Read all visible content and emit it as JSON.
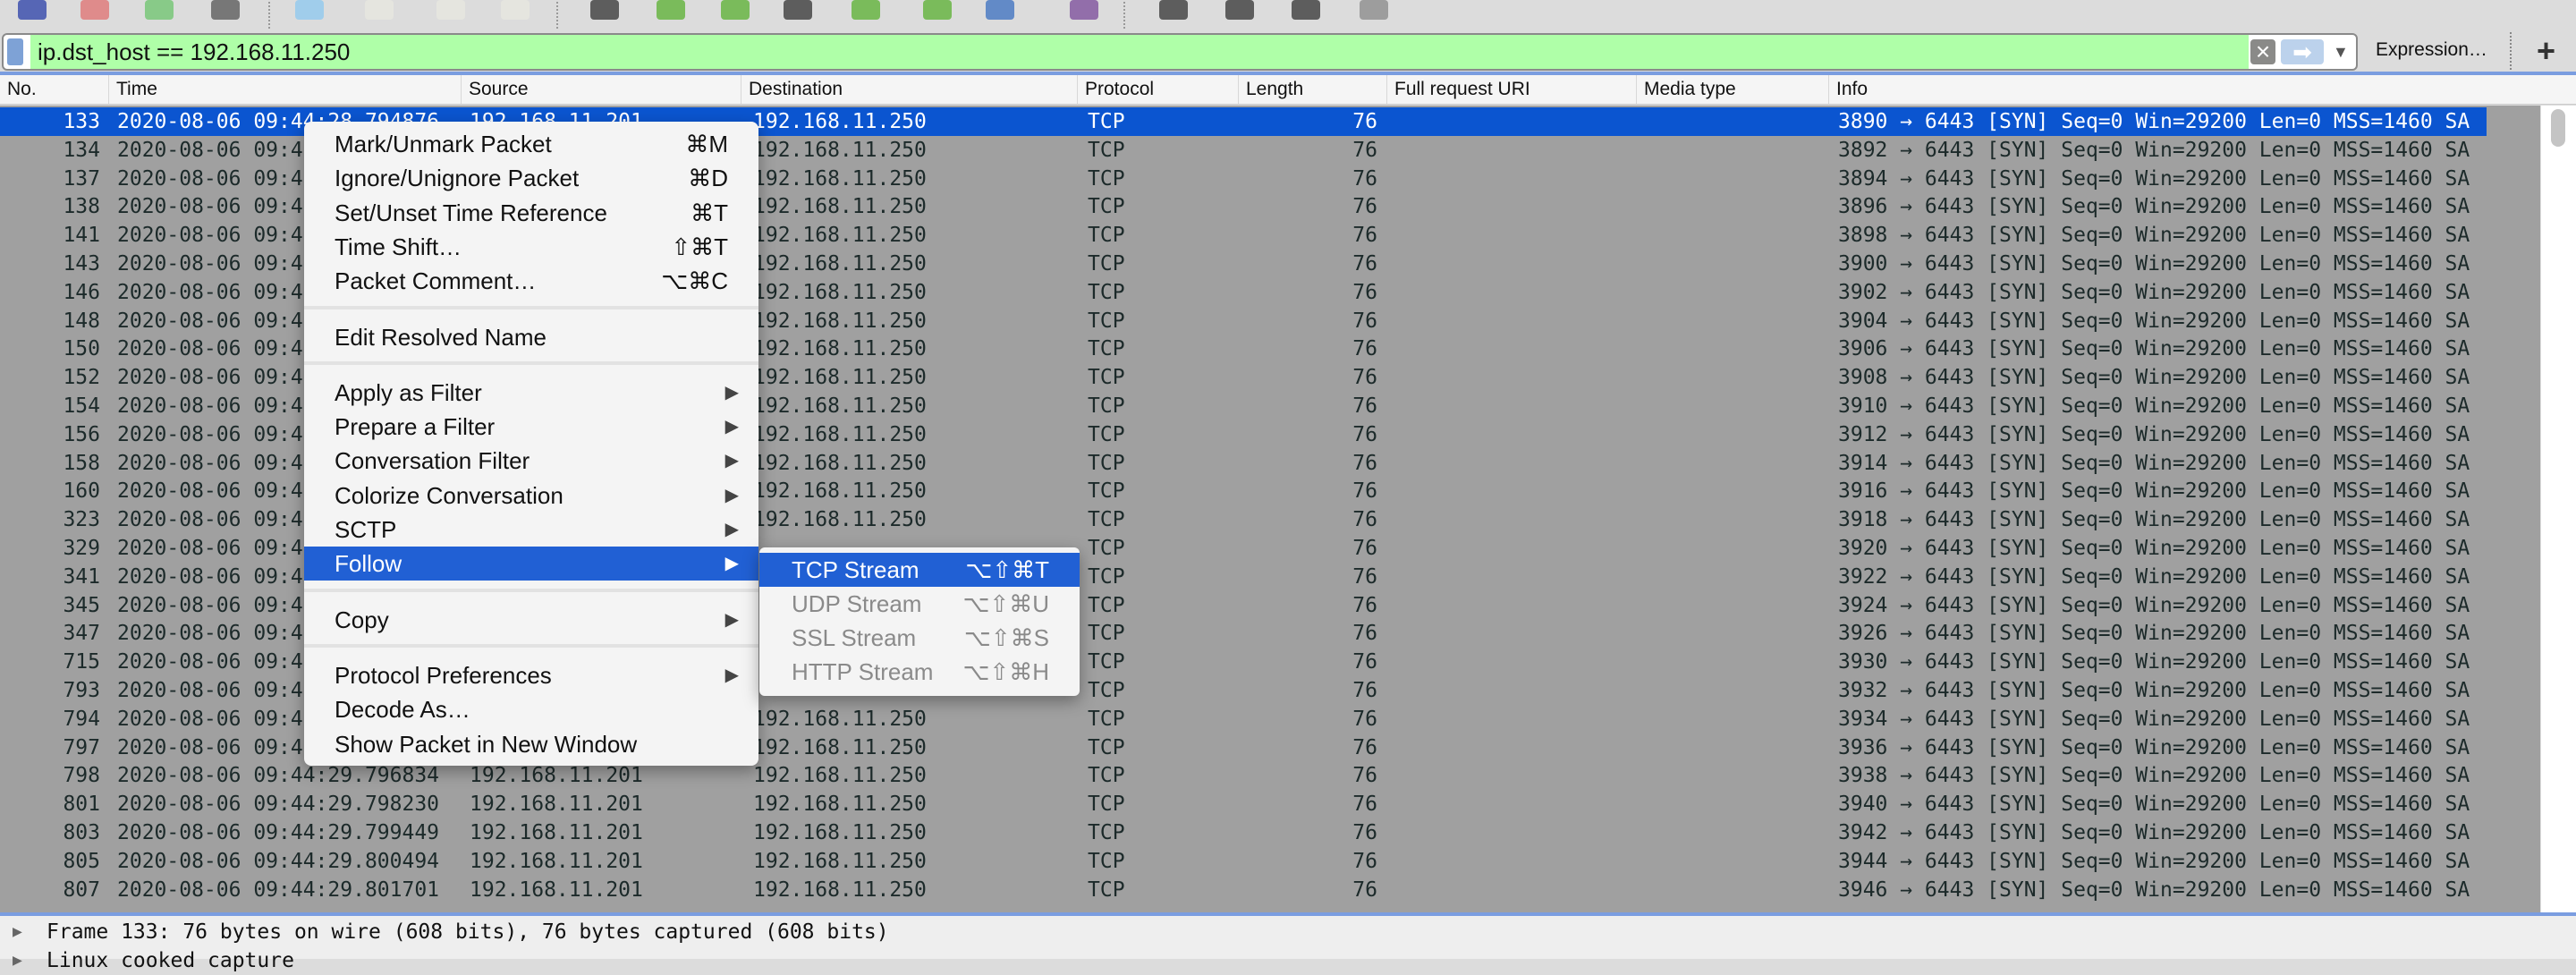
{
  "colors": {
    "accent": "#2160d4",
    "selected_row": "#0b55d0",
    "filter_valid": "#afffa8"
  },
  "toolbar": {
    "icons": [
      "shark-fin-start-icon",
      "stop-icon",
      "restart-icon",
      "options-gear-icon",
      "open-file-icon",
      "save-file-icon",
      "close-file-icon",
      "reload-file-icon",
      "find-packet-icon",
      "go-back-icon",
      "go-forward-icon",
      "go-to-packet-icon",
      "go-first-icon",
      "go-last-icon",
      "autoscroll-icon",
      "colorize-icon",
      "zoom-in-icon",
      "zoom-out-icon",
      "zoom-normal-icon",
      "resize-columns-icon"
    ]
  },
  "filter": {
    "value": "ip.dst_host == 192.168.11.250",
    "clear_icon": "clear-x-icon",
    "apply_icon": "arrow-right-icon",
    "expression_label": "Expression…",
    "add_label": "+"
  },
  "columns": [
    "No.",
    "Time",
    "Source",
    "Destination",
    "Protocol",
    "Length",
    "Full request URI",
    "Media type",
    "Info"
  ],
  "packets": [
    {
      "no": "133",
      "time": "2020-08-06 09:44:28.794876",
      "src": "192.168.11.201",
      "dst": "192.168.11.250",
      "proto": "TCP",
      "len": "76",
      "info": "3890 → 6443 [SYN] Seq=0 Win=29200 Len=0 MSS=1460 SA"
    },
    {
      "no": "134",
      "time": "2020-08-06 09:4",
      "src": "",
      "dst": "192.168.11.250",
      "proto": "TCP",
      "len": "76",
      "info": "3892 → 6443 [SYN] Seq=0 Win=29200 Len=0 MSS=1460 SA"
    },
    {
      "no": "137",
      "time": "2020-08-06 09:4",
      "src": "",
      "dst": "192.168.11.250",
      "proto": "TCP",
      "len": "76",
      "info": "3894 → 6443 [SYN] Seq=0 Win=29200 Len=0 MSS=1460 SA"
    },
    {
      "no": "138",
      "time": "2020-08-06 09:4",
      "src": "",
      "dst": "192.168.11.250",
      "proto": "TCP",
      "len": "76",
      "info": "3896 → 6443 [SYN] Seq=0 Win=29200 Len=0 MSS=1460 SA"
    },
    {
      "no": "141",
      "time": "2020-08-06 09:4",
      "src": "",
      "dst": "192.168.11.250",
      "proto": "TCP",
      "len": "76",
      "info": "3898 → 6443 [SYN] Seq=0 Win=29200 Len=0 MSS=1460 SA"
    },
    {
      "no": "143",
      "time": "2020-08-06 09:4",
      "src": "",
      "dst": "192.168.11.250",
      "proto": "TCP",
      "len": "76",
      "info": "3900 → 6443 [SYN] Seq=0 Win=29200 Len=0 MSS=1460 SA"
    },
    {
      "no": "146",
      "time": "2020-08-06 09:4",
      "src": "",
      "dst": "192.168.11.250",
      "proto": "TCP",
      "len": "76",
      "info": "3902 → 6443 [SYN] Seq=0 Win=29200 Len=0 MSS=1460 SA"
    },
    {
      "no": "148",
      "time": "2020-08-06 09:4",
      "src": "",
      "dst": "192.168.11.250",
      "proto": "TCP",
      "len": "76",
      "info": "3904 → 6443 [SYN] Seq=0 Win=29200 Len=0 MSS=1460 SA"
    },
    {
      "no": "150",
      "time": "2020-08-06 09:4",
      "src": "",
      "dst": "192.168.11.250",
      "proto": "TCP",
      "len": "76",
      "info": "3906 → 6443 [SYN] Seq=0 Win=29200 Len=0 MSS=1460 SA"
    },
    {
      "no": "152",
      "time": "2020-08-06 09:4",
      "src": "",
      "dst": "192.168.11.250",
      "proto": "TCP",
      "len": "76",
      "info": "3908 → 6443 [SYN] Seq=0 Win=29200 Len=0 MSS=1460 SA"
    },
    {
      "no": "154",
      "time": "2020-08-06 09:4",
      "src": "",
      "dst": "192.168.11.250",
      "proto": "TCP",
      "len": "76",
      "info": "3910 → 6443 [SYN] Seq=0 Win=29200 Len=0 MSS=1460 SA"
    },
    {
      "no": "156",
      "time": "2020-08-06 09:4",
      "src": "",
      "dst": "192.168.11.250",
      "proto": "TCP",
      "len": "76",
      "info": "3912 → 6443 [SYN] Seq=0 Win=29200 Len=0 MSS=1460 SA"
    },
    {
      "no": "158",
      "time": "2020-08-06 09:4",
      "src": "",
      "dst": "192.168.11.250",
      "proto": "TCP",
      "len": "76",
      "info": "3914 → 6443 [SYN] Seq=0 Win=29200 Len=0 MSS=1460 SA"
    },
    {
      "no": "160",
      "time": "2020-08-06 09:4",
      "src": "",
      "dst": "192.168.11.250",
      "proto": "TCP",
      "len": "76",
      "info": "3916 → 6443 [SYN] Seq=0 Win=29200 Len=0 MSS=1460 SA"
    },
    {
      "no": "323",
      "time": "2020-08-06 09:4",
      "src": "",
      "dst": "192.168.11.250",
      "proto": "TCP",
      "len": "76",
      "info": "3918 → 6443 [SYN] Seq=0 Win=29200 Len=0 MSS=1460 SA"
    },
    {
      "no": "329",
      "time": "2020-08-06 09:4",
      "src": "",
      "dst": "",
      "proto": "TCP",
      "len": "76",
      "info": "3920 → 6443 [SYN] Seq=0 Win=29200 Len=0 MSS=1460 SA"
    },
    {
      "no": "341",
      "time": "2020-08-06 09:4",
      "src": "",
      "dst": "",
      "proto": "TCP",
      "len": "76",
      "info": "3922 → 6443 [SYN] Seq=0 Win=29200 Len=0 MSS=1460 SA"
    },
    {
      "no": "345",
      "time": "2020-08-06 09:4",
      "src": "",
      "dst": "",
      "proto": "TCP",
      "len": "76",
      "info": "3924 → 6443 [SYN] Seq=0 Win=29200 Len=0 MSS=1460 SA"
    },
    {
      "no": "347",
      "time": "2020-08-06 09:4",
      "src": "",
      "dst": "",
      "proto": "TCP",
      "len": "76",
      "info": "3926 → 6443 [SYN] Seq=0 Win=29200 Len=0 MSS=1460 SA"
    },
    {
      "no": "715",
      "time": "2020-08-06 09:4",
      "src": "",
      "dst": "",
      "proto": "TCP",
      "len": "76",
      "info": "3930 → 6443 [SYN] Seq=0 Win=29200 Len=0 MSS=1460 SA"
    },
    {
      "no": "793",
      "time": "2020-08-06 09:4",
      "src": "",
      "dst": "",
      "proto": "TCP",
      "len": "76",
      "info": "3932 → 6443 [SYN] Seq=0 Win=29200 Len=0 MSS=1460 SA"
    },
    {
      "no": "794",
      "time": "2020-08-06 09:4",
      "src": "",
      "dst": "192.168.11.250",
      "proto": "TCP",
      "len": "76",
      "info": "3934 → 6443 [SYN] Seq=0 Win=29200 Len=0 MSS=1460 SA"
    },
    {
      "no": "797",
      "time": "2020-08-06 09:4",
      "src": "",
      "dst": "192.168.11.250",
      "proto": "TCP",
      "len": "76",
      "info": "3936 → 6443 [SYN] Seq=0 Win=29200 Len=0 MSS=1460 SA"
    },
    {
      "no": "798",
      "time": "2020-08-06 09:44:29.796834",
      "src": "192.168.11.201",
      "dst": "192.168.11.250",
      "proto": "TCP",
      "len": "76",
      "info": "3938 → 6443 [SYN] Seq=0 Win=29200 Len=0 MSS=1460 SA"
    },
    {
      "no": "801",
      "time": "2020-08-06 09:44:29.798230",
      "src": "192.168.11.201",
      "dst": "192.168.11.250",
      "proto": "TCP",
      "len": "76",
      "info": "3940 → 6443 [SYN] Seq=0 Win=29200 Len=0 MSS=1460 SA"
    },
    {
      "no": "803",
      "time": "2020-08-06 09:44:29.799449",
      "src": "192.168.11.201",
      "dst": "192.168.11.250",
      "proto": "TCP",
      "len": "76",
      "info": "3942 → 6443 [SYN] Seq=0 Win=29200 Len=0 MSS=1460 SA"
    },
    {
      "no": "805",
      "time": "2020-08-06 09:44:29.800494",
      "src": "192.168.11.201",
      "dst": "192.168.11.250",
      "proto": "TCP",
      "len": "76",
      "info": "3944 → 6443 [SYN] Seq=0 Win=29200 Len=0 MSS=1460 SA"
    },
    {
      "no": "807",
      "time": "2020-08-06 09:44:29.801701",
      "src": "192.168.11.201",
      "dst": "192.168.11.250",
      "proto": "TCP",
      "len": "76",
      "info": "3946 → 6443 [SYN] Seq=0 Win=29200 Len=0 MSS=1460 SA"
    }
  ],
  "details": [
    "Frame 133: 76 bytes on wire (608 bits), 76 bytes captured (608 bits)",
    "Linux cooked capture"
  ],
  "context_menu": {
    "groups": [
      [
        {
          "label": "Mark/Unmark Packet",
          "shortcut": "⌘M"
        },
        {
          "label": "Ignore/Unignore Packet",
          "shortcut": "⌘D"
        },
        {
          "label": "Set/Unset Time Reference",
          "shortcut": "⌘T"
        },
        {
          "label": "Time Shift…",
          "shortcut": "⇧⌘T"
        },
        {
          "label": "Packet Comment…",
          "shortcut": "⌥⌘C"
        }
      ],
      [
        {
          "label": "Edit Resolved Name"
        }
      ],
      [
        {
          "label": "Apply as Filter",
          "submenu": true
        },
        {
          "label": "Prepare a Filter",
          "submenu": true
        },
        {
          "label": "Conversation Filter",
          "submenu": true
        },
        {
          "label": "Colorize Conversation",
          "submenu": true
        },
        {
          "label": "SCTP",
          "submenu": true
        },
        {
          "label": "Follow",
          "submenu": true,
          "highlighted": true
        }
      ],
      [
        {
          "label": "Copy",
          "submenu": true
        }
      ],
      [
        {
          "label": "Protocol Preferences",
          "submenu": true
        },
        {
          "label": "Decode As…"
        },
        {
          "label": "Show Packet in New Window"
        }
      ]
    ]
  },
  "follow_submenu": [
    {
      "label": "TCP Stream",
      "shortcut": "⌥⇧⌘T",
      "enabled": true,
      "highlighted": true
    },
    {
      "label": "UDP Stream",
      "shortcut": "⌥⇧⌘U",
      "enabled": false
    },
    {
      "label": "SSL Stream",
      "shortcut": "⌥⇧⌘S",
      "enabled": false
    },
    {
      "label": "HTTP Stream",
      "shortcut": "⌥⇧⌘H",
      "enabled": false
    }
  ]
}
